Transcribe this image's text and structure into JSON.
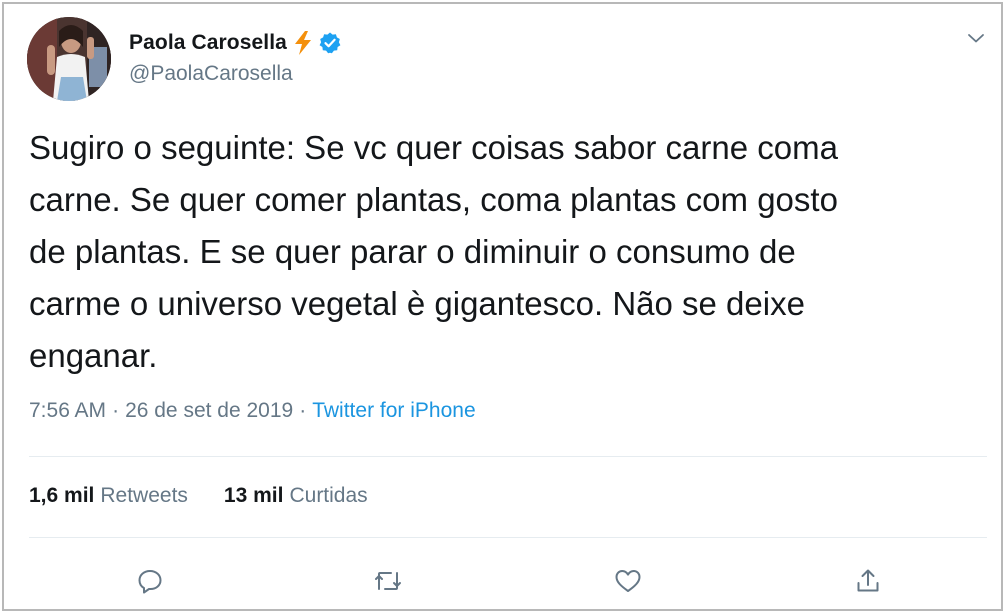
{
  "author": {
    "display_name": "Paola Carosella",
    "handle": "@PaolaCarosella",
    "emoji_icon": "lightning-bolt-icon",
    "verified_icon": "verified-badge-icon",
    "verified_color": "#1da1f2",
    "bolt_color": "#f4900c"
  },
  "tweet": {
    "text": "Sugiro o seguinte: Se vc quer coisas sabor carne coma\ncarne. Se quer comer plantas, coma plantas com gosto\nde plantas. E se quer parar o diminuir o consumo de\ncarme o universo vegetal è gigantesco. Não se deixe\nenganar.",
    "time": "7:56 AM",
    "date": "26 de set de 2019",
    "separator": "·",
    "source": "Twitter for iPhone"
  },
  "stats": {
    "retweets_count": "1,6 mil",
    "retweets_label": "Retweets",
    "likes_count": "13 mil",
    "likes_label": "Curtidas"
  },
  "actions": [
    {
      "name": "reply",
      "icon": "reply-icon"
    },
    {
      "name": "retweet",
      "icon": "retweet-icon"
    },
    {
      "name": "like",
      "icon": "heart-icon"
    },
    {
      "name": "share",
      "icon": "share-icon"
    }
  ],
  "colors": {
    "text": "#14171a",
    "secondary": "#657786",
    "link": "#1b95e0",
    "divider": "#e6ecf0",
    "frame_border": "#b8b8b8"
  }
}
